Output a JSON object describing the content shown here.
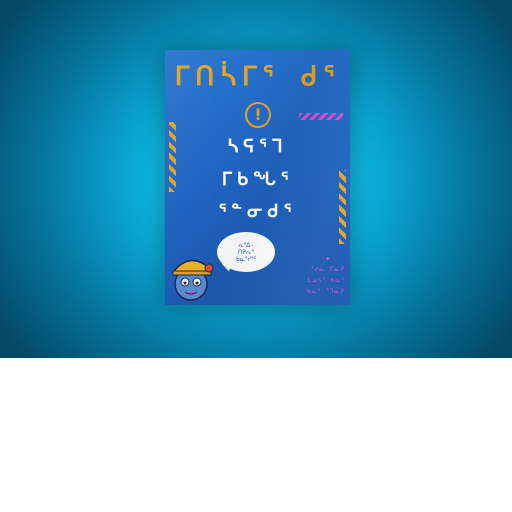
{
  "poster": {
    "title": "ᒥᑎᓵᒥᕐ ᑯᕐ",
    "line1": "ᓴᕋᕐᒣ",
    "line2": "ᒥᑲᖓᕐ",
    "line3": "ᕐᓐᓂᑯᕐ",
    "alert_symbol": "!",
    "bubble_lines": [
      "ᕆᕐᐃ-",
      "ᑎᕈᕆᕐ",
      "ᑲᓇᕐᓯᕐᑦ"
    ],
    "star_symbol": "✦",
    "credits": [
      "ᕐᓱᓇ ᒥᓇᕈ",
      "ᒪᓄᓴᕐ ᑲᓇᑦ",
      "ᑲᓇᑦ ᕐᒣᓇᕈ"
    ]
  },
  "colors": {
    "background_glow": "#2fe3ff",
    "poster_blue": "#2874cf",
    "accent_orange": "#e4a322",
    "accent_pink": "#d650d6",
    "text_white": "#ffffff"
  }
}
